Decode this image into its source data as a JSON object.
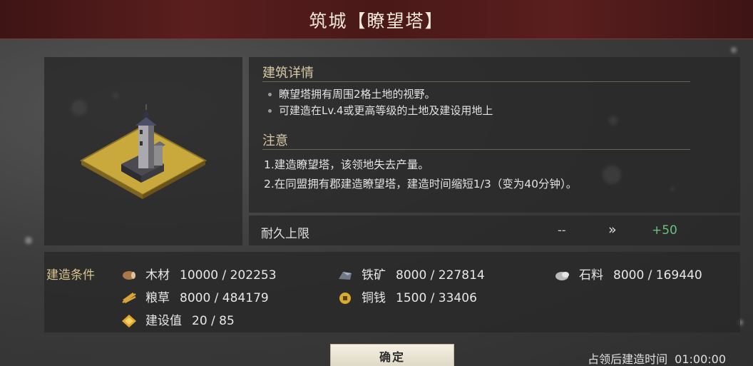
{
  "title": "筑城【瞭望塔】",
  "details": {
    "heading": "建筑详情",
    "bullets": [
      "瞭望塔拥有周围2格土地的视野。",
      "可建造在Lv.4或更高等级的土地及建设用地上"
    ]
  },
  "notice": {
    "heading": "注意",
    "lines": [
      "1.建造瞭望塔，该领地失去产量。",
      "2.在同盟拥有郡建造瞭望塔，建造时间缩短1/3（变为40分钟）。"
    ]
  },
  "durability": {
    "label": "耐久上限",
    "current": "--",
    "arrow": "»",
    "next": "+50",
    "next_color": "#69c27b"
  },
  "conditions": {
    "label": "建造条件",
    "resources": [
      {
        "name": "木材",
        "value": "10000 / 202253",
        "icon": "wood-icon"
      },
      {
        "name": "铁矿",
        "value": "8000 / 227814",
        "icon": "iron-icon"
      },
      {
        "name": "石料",
        "value": "8000 / 169440",
        "icon": "stone-icon"
      },
      {
        "name": "粮草",
        "value": "8000 / 484179",
        "icon": "grain-icon"
      },
      {
        "name": "铜钱",
        "value": "1500 / 33406",
        "icon": "coin-icon"
      },
      {
        "name": "建设值",
        "value": "20 / 85",
        "icon": "construction-icon"
      }
    ]
  },
  "confirm_label": "确定",
  "build_time": {
    "label": "占领后建造时间",
    "value": "01:00:00"
  }
}
